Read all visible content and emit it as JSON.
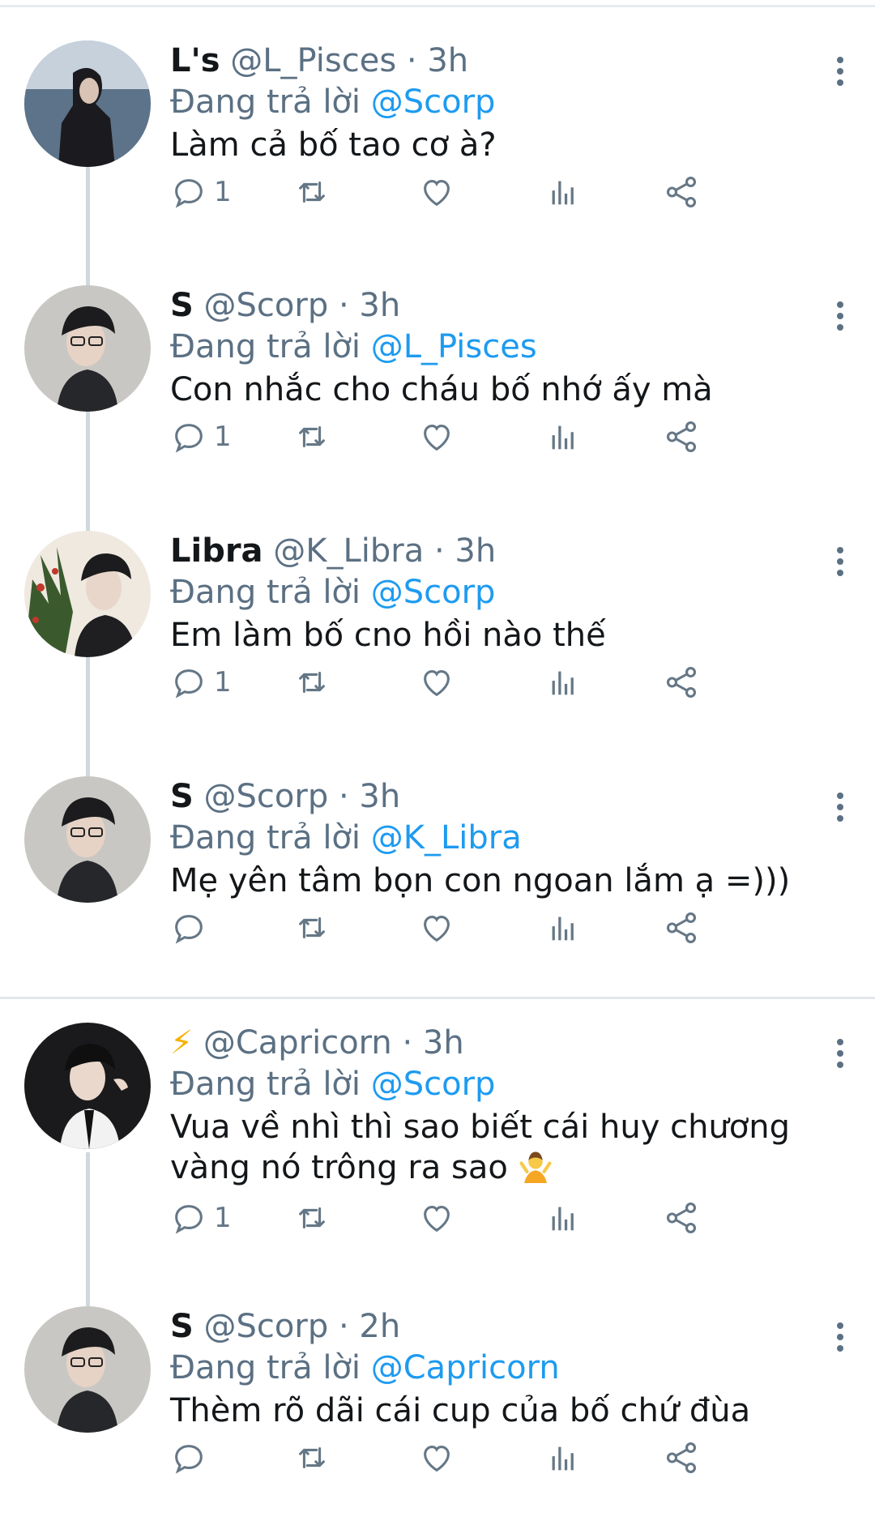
{
  "tweets": [
    {
      "name": "L's",
      "handle": "@L_Pisces",
      "time": "3h",
      "reply_prefix": "Đang trả lời",
      "reply_to": "@Scorp",
      "text": "Làm cả bố tao cơ à?",
      "reply_count": "1",
      "avatar_icon": "avatar-photo"
    },
    {
      "name": "S",
      "handle": "@Scorp",
      "time": "3h",
      "reply_prefix": "Đang trả lời",
      "reply_to": "@L_Pisces",
      "text": "Con nhắc cho cháu bố nhớ ấy mà",
      "reply_count": "1",
      "avatar_icon": "avatar-photo"
    },
    {
      "name": "Libra",
      "handle": "@K_Libra",
      "time": "3h",
      "reply_prefix": "Đang trả lời",
      "reply_to": "@Scorp",
      "text": "Em làm bố cno hồi nào thế",
      "reply_count": "1",
      "avatar_icon": "avatar-photo"
    },
    {
      "name": "S",
      "handle": "@Scorp",
      "time": "3h",
      "reply_prefix": "Đang trả lời",
      "reply_to": "@K_Libra",
      "text": "Mẹ yên tâm bọn con ngoan lắm ạ =)))",
      "reply_count": "",
      "avatar_icon": "avatar-photo"
    },
    {
      "name": "⚡",
      "handle": "@Capricorn",
      "time": "3h",
      "reply_prefix": "Đang trả lời",
      "reply_to": "@Scorp",
      "text_line1": "Vua về nhì thì sao biết cái huy chương",
      "text_line2": "vàng nó trông ra sao",
      "reply_count": "1",
      "avatar_icon": "avatar-photo"
    },
    {
      "name": "S",
      "handle": "@Scorp",
      "time": "2h",
      "reply_prefix": "Đang trả lời",
      "reply_to": "@Capricorn",
      "text": "Thèm rõ dãi cái cup của bố chứ đùa",
      "reply_count": "",
      "avatar_icon": "avatar-photo"
    }
  ],
  "separator": "·",
  "icons": {
    "more": "more-vertical-icon",
    "reply": "reply-bubble-icon",
    "retweet": "retweet-icon",
    "like": "heart-icon",
    "analytics": "analytics-bars-icon",
    "share": "share-icon",
    "emoji": "person-shrugging-emoji"
  },
  "colors": {
    "link": "#1d9bf0",
    "secondary": "#5b7083",
    "text": "#14171a",
    "thread_line": "#cfd9de"
  }
}
